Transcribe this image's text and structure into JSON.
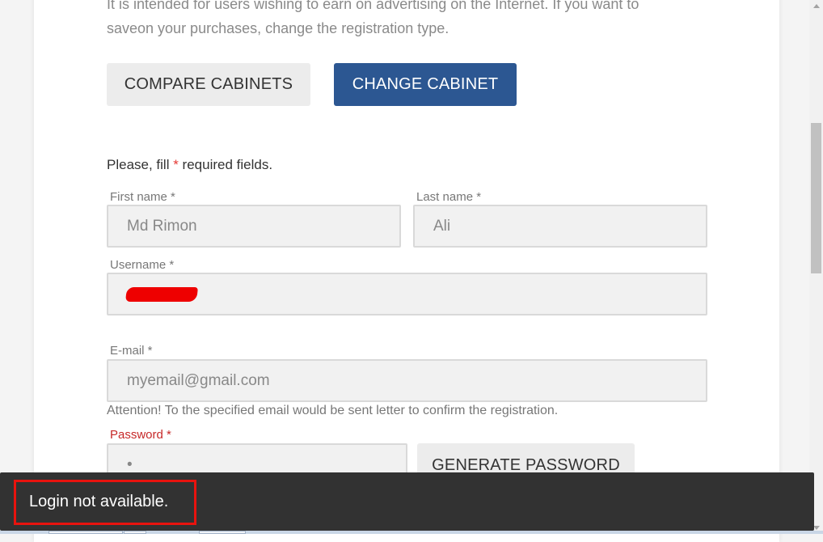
{
  "intro": {
    "line1": "It is intended for users wishing to earn on advertising on the Internet. If you want to",
    "line2": "saveon your purchases, change the registration type."
  },
  "buttons": {
    "compare_cabinets": "COMPARE CABINETS",
    "change_cabinet": "CHANGE CABINET",
    "generate_password": "GENERATE PASSWORD"
  },
  "form": {
    "required_note_prefix": "Please, fill ",
    "required_star": "*",
    "required_note_suffix": " required fields.",
    "first_name": {
      "label": "First name *",
      "value": "Md Rimon"
    },
    "last_name": {
      "label": "Last name *",
      "value": "Ali"
    },
    "username": {
      "label": "Username *",
      "value": ""
    },
    "email": {
      "label": "E-mail *",
      "value": "myemail@gmail.com"
    },
    "attention": "Attention! To the specified email would be sent letter to confirm the registration.",
    "password": {
      "label": "Password *",
      "value": "•"
    }
  },
  "toast": {
    "message": "Login not available."
  },
  "colors": {
    "primary_button": "#2c5792",
    "error_label": "#c62828",
    "toast_bg": "#323232",
    "highlight": "#e8130e"
  }
}
